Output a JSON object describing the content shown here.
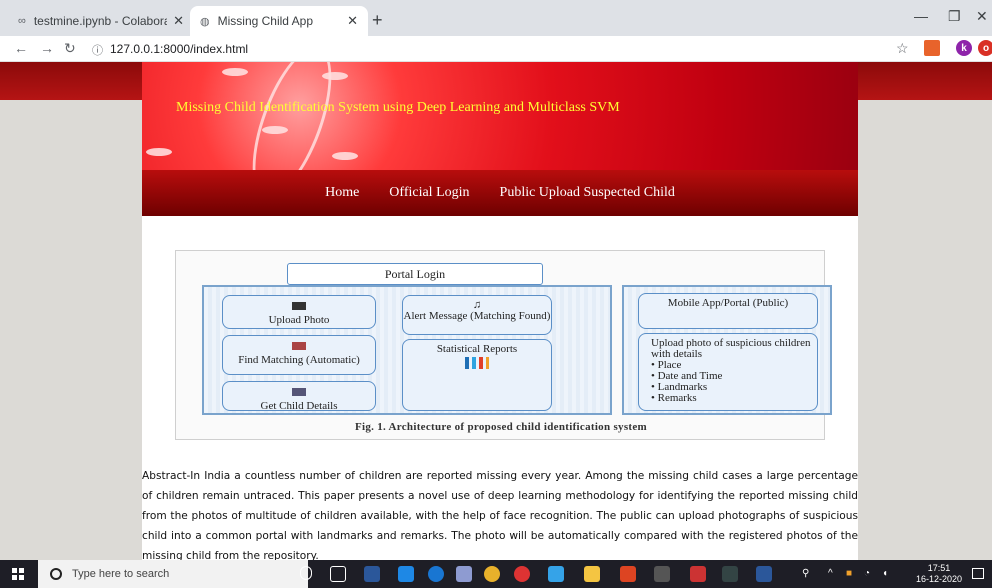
{
  "browser": {
    "tabs": [
      {
        "label": "testmine.ipynb - Colaboratory",
        "icon": "colab-icon"
      },
      {
        "label": "Missing Child App",
        "icon": "globe-icon"
      }
    ],
    "url": "127.0.0.1:8000/index.html"
  },
  "site": {
    "banner_title": "Missing Child Identification System using Deep Learning and Multiclass SVM",
    "nav": [
      "Home",
      "Official Login",
      "Public Upload Suspected Child"
    ]
  },
  "figure": {
    "portal": "Portal Login",
    "left_boxes": [
      "Upload Photo",
      "Find Matching (Automatic)",
      "Get Child Details"
    ],
    "mid_boxes": [
      "Alert Message (Matching Found)",
      "Statistical Reports"
    ],
    "right_top": "Mobile App/Portal (Public)",
    "right_bottom_title": "Upload photo of suspicious children with details",
    "right_bottom_items": [
      "Place",
      "Date and Time",
      "Landmarks",
      "Remarks"
    ],
    "caption": "Fig. 1.   Architecture of proposed child identification system"
  },
  "abstract": "Abstract-In India a countless number of children are reported missing every year. Among the missing child cases a large percentage of children remain untraced. This paper presents a novel use of deep learning methodology for identifying the reported missing child from the photos of multitude of children available, with the help of face recognition. The public can upload photographs of suspicious child into a common portal with landmarks and remarks. The photo will be automatically compared with the registered photos of the missing child from the repository.",
  "taskbar": {
    "search_placeholder": "Type here to search",
    "time": "17:51",
    "date": "16-12-2020"
  },
  "colors": {
    "banner_red": "#e20f1a",
    "nav_dark": "#6e0000",
    "title_yellow": "#ffff33"
  }
}
